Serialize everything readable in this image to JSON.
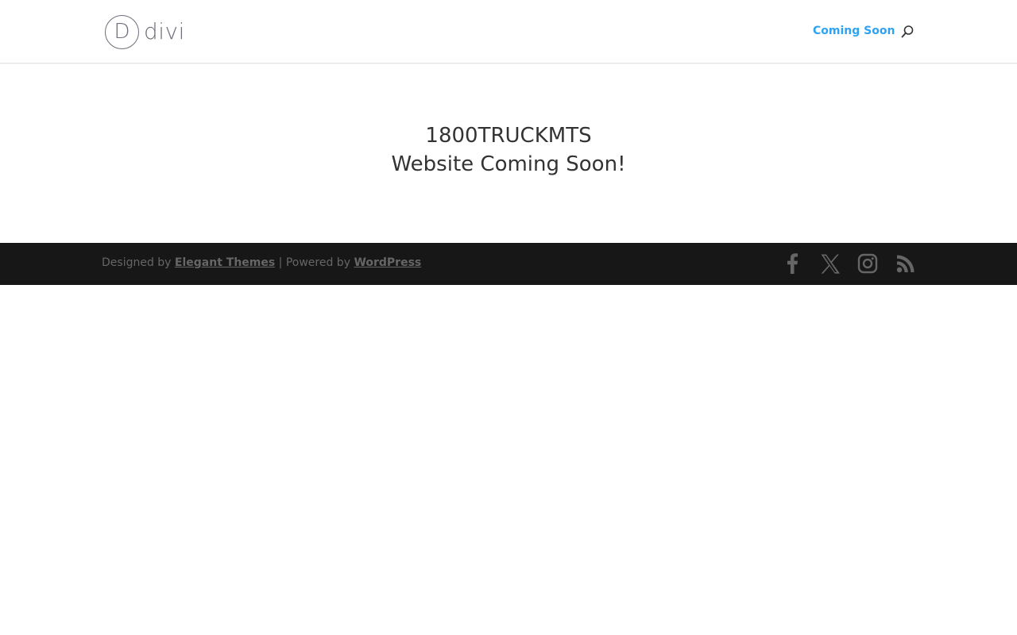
{
  "header": {
    "logo_mark": "D",
    "logo_text": "divi",
    "nav": {
      "coming_soon": "Coming Soon"
    },
    "search_icon": "search-icon"
  },
  "main": {
    "headline_line1": "1800TRUCKMTS",
    "headline_line2": "Website Coming Soon!"
  },
  "footer": {
    "designed_by": "Designed by ",
    "elegant_themes": "Elegant Themes",
    "powered_by": " | Powered by ",
    "wordpress": "WordPress",
    "social_icons": [
      "facebook-icon",
      "x-icon",
      "instagram-icon",
      "rss-icon"
    ]
  },
  "colors": {
    "accent": "#2ea3f2",
    "footer_bg": "#171717",
    "footer_text": "#666666",
    "logo": "#6e6e7a"
  }
}
